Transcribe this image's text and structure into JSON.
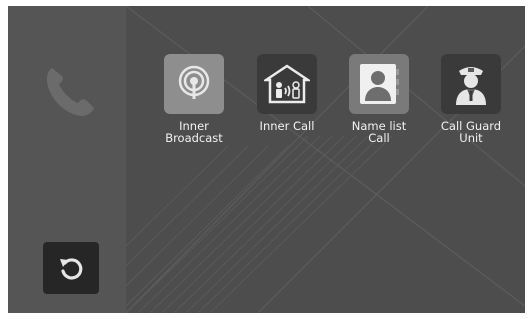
{
  "tiles": [
    {
      "label": "Inner\nBroadcast",
      "icon": "broadcast-icon"
    },
    {
      "label": "Inner Call",
      "icon": "home-intercom-icon"
    },
    {
      "label": "Name list\nCall",
      "icon": "contact-book-icon"
    },
    {
      "label": "Call Guard\nUnit",
      "icon": "security-guard-icon"
    }
  ],
  "left_panel": {
    "icon": "phone-icon",
    "back_icon": "back-icon"
  },
  "colors": {
    "screen": "#4d4d4d",
    "panel": "#555555",
    "tile_dark": "#3a3a3a",
    "tile_light": "#8e8e8e"
  }
}
